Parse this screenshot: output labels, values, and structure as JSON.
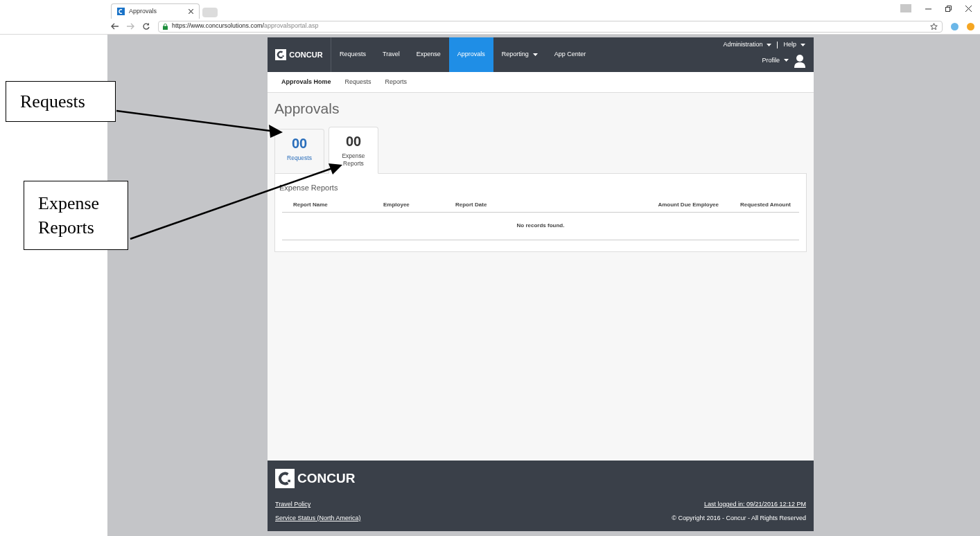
{
  "browser": {
    "tab_title": "Approvals",
    "url_host": "https://www.concursolutions.com/",
    "url_path": "approvalsportal.asp"
  },
  "header": {
    "logo": "CONCUR",
    "nav": [
      {
        "label": "Requests",
        "selected": false,
        "dropdown": false
      },
      {
        "label": "Travel",
        "selected": false,
        "dropdown": false
      },
      {
        "label": "Expense",
        "selected": false,
        "dropdown": false
      },
      {
        "label": "Approvals",
        "selected": true,
        "dropdown": false
      },
      {
        "label": "Reporting",
        "selected": false,
        "dropdown": true
      },
      {
        "label": "App Center",
        "selected": false,
        "dropdown": false
      }
    ],
    "top_links": [
      "Administration",
      "Help"
    ],
    "profile": "Profile"
  },
  "subnav": [
    {
      "label": "Approvals Home",
      "selected": true
    },
    {
      "label": "Requests",
      "selected": false
    },
    {
      "label": "Reports",
      "selected": false
    }
  ],
  "title": "Approvals",
  "tiles": [
    {
      "count": "00",
      "label": "Requests",
      "selected": false
    },
    {
      "count": "00",
      "label": "Expense Reports",
      "selected": true
    }
  ],
  "panel": {
    "title": "Expense Reports",
    "columns": [
      "Report Name",
      "Employee",
      "Report Date",
      "Amount Due Employee",
      "Requested Amount"
    ],
    "empty": "No records found."
  },
  "footer": {
    "logo": "CONCUR",
    "links": [
      "Travel Policy",
      "Service Status (North America)"
    ],
    "last_logged": "Last logged in: 09/21/2016 12:12 PM",
    "copyright": "© Copyright 2016 - Concur - All Rights Reserved"
  },
  "annotations": [
    {
      "label": "Requests"
    },
    {
      "label": "Expense Reports"
    }
  ]
}
